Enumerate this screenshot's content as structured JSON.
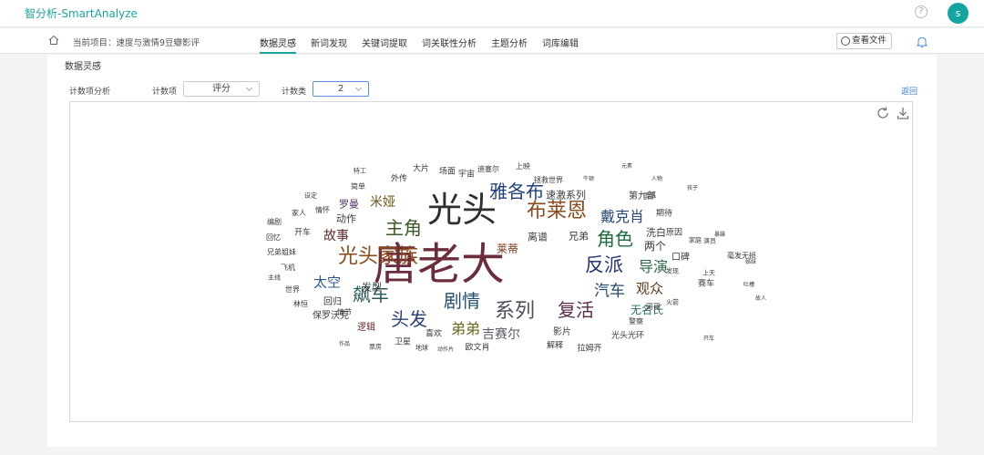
{
  "app": {
    "title": "智分析-SmartAnalyze",
    "help": "?",
    "avatar": "s"
  },
  "nav": {
    "project": "当前项目：速度与激情9豆瓣影评",
    "tabs": [
      "数据灵感",
      "新词发现",
      "关键词提取",
      "词关联性分析",
      "主题分析",
      "词库编辑"
    ],
    "view_file": "查看文件"
  },
  "subtab": "数据灵感",
  "controls": {
    "analysis_label": "计数项分析",
    "count_item_label": "计数项",
    "count_item_value": "评分",
    "count_class_label": "计数类",
    "count_class_value": "2",
    "back": "返回"
  },
  "colors": {
    "accent": "#15a5a0",
    "link": "#3a7bd5"
  },
  "cloud_words": [
    [
      "唐老大",
      48,
      "#6b2c3c"
    ],
    [
      "光头",
      38,
      "#2f2f2f"
    ],
    [
      "光头家族",
      22,
      "#8a4a1c"
    ],
    [
      "布莱恩",
      22,
      "#8a4a1c"
    ],
    [
      "雅各布",
      20,
      "#1f3f7a"
    ],
    [
      "剧情",
      20,
      "#23506e"
    ],
    [
      "系列",
      22,
      "#4e4e5c"
    ],
    [
      "反派",
      21,
      "#27356e"
    ],
    [
      "主角",
      20,
      "#3b5a2a"
    ],
    [
      "角色",
      20,
      "#1e6b3e"
    ],
    [
      "戴克肖",
      16,
      "#274a7a"
    ],
    [
      "复活",
      20,
      "#5a2c4a"
    ],
    [
      "头发",
      20,
      "#2a3f7a"
    ],
    [
      "飙车",
      20,
      "#2a5a5a"
    ],
    [
      "汽车",
      17,
      "#264a6a"
    ],
    [
      "导演",
      16,
      "#2a6a4a"
    ],
    [
      "观众",
      15,
      "#5a3a1a"
    ],
    [
      "弟弟",
      16,
      "#6a6a1a"
    ],
    [
      "太空",
      15,
      "#2a5a8a"
    ],
    [
      "故事",
      14,
      "#5a2a2a"
    ],
    [
      "米娅",
      14,
      "#6a5a1a"
    ],
    [
      "吉赛尔",
      14,
      "#5a5a6a"
    ],
    [
      "莱蒂",
      12,
      "#7a3a1a"
    ],
    [
      "无名氏",
      12,
      "#2a6a6a"
    ],
    [
      "速激系列",
      11,
      "#3a3a3a"
    ],
    [
      "第九部",
      10,
      "#3a3a3a"
    ],
    [
      "两个",
      12,
      "#3a3a3a"
    ],
    [
      "洗白",
      11,
      "#3a3a3a"
    ],
    [
      "兄弟",
      11,
      "#3a3a3a"
    ],
    [
      "离谱",
      11,
      "#3a3a3a"
    ],
    [
      "动作",
      11,
      "#3a3a3a"
    ],
    [
      "罗曼",
      11,
      "#5a3a6a"
    ],
    [
      "发型",
      11,
      "#3a3a3a"
    ],
    [
      "回归",
      10,
      "#3a3a3a"
    ],
    [
      "保罗沃克",
      10,
      "#3a3a3a"
    ],
    [
      "逻辑",
      10,
      "#6a2a2a"
    ],
    [
      "影片",
      10,
      "#3a3a3a"
    ],
    [
      "光头光环",
      9,
      "#3a3a3a"
    ],
    [
      "喜欢",
      9,
      "#3a3a3a"
    ],
    [
      "欧文肖",
      9,
      "#3a3a3a"
    ],
    [
      "卫星",
      9,
      "#3a3a3a"
    ],
    [
      "解释",
      9,
      "#3a3a3a"
    ],
    [
      "拉姆齐",
      9,
      "#3a3a3a"
    ],
    [
      "口碑",
      10,
      "#3a3a3a"
    ],
    [
      "赛车",
      9,
      "#3a3a3a"
    ],
    [
      "期待",
      9,
      "#3a3a3a"
    ],
    [
      "原因",
      9,
      "#3a3a3a"
    ],
    [
      "开车",
      9,
      "#3a3a3a"
    ],
    [
      "外传",
      9,
      "#3a3a3a"
    ],
    [
      "大片",
      9,
      "#3a3a3a"
    ],
    [
      "场面",
      9,
      "#3a3a3a"
    ],
    [
      "宇宙",
      9,
      "#3a3a3a"
    ],
    [
      "上映",
      8,
      "#3a3a3a"
    ],
    [
      "迪塞尔",
      8,
      "#3a3a3a"
    ],
    [
      "拯救世界",
      8,
      "#3a3a3a"
    ],
    [
      "家人",
      8,
      "#3a3a3a"
    ],
    [
      "情怀",
      8,
      "#3a3a3a"
    ],
    [
      "编剧",
      8,
      "#3a3a3a"
    ],
    [
      "回忆",
      8,
      "#3a3a3a"
    ],
    [
      "飞机",
      8,
      "#3a3a3a"
    ],
    [
      "世界",
      8,
      "#3a3a3a"
    ],
    [
      "林恒",
      8,
      "#3a3a3a"
    ],
    [
      "情节",
      8,
      "#3a3a3a"
    ],
    [
      "警察",
      8,
      "#3a3a3a"
    ],
    [
      "哥哥",
      8,
      "#3a3a3a"
    ],
    [
      "团队",
      7,
      "#3a3a3a"
    ],
    [
      "简单",
      8,
      "#3a3a3a"
    ],
    [
      "特工",
      7,
      "#3a3a3a"
    ],
    [
      "兄弟姐妹",
      8,
      "#3a3a3a"
    ],
    [
      "主线",
      7,
      "#3a3a3a"
    ],
    [
      "火箭",
      7,
      "#3a3a3a"
    ],
    [
      "家庭",
      7,
      "#3a3a3a"
    ],
    [
      "上天",
      7,
      "#3a3a3a"
    ],
    [
      "演员",
      7,
      "#3a3a3a"
    ],
    [
      "毫发无损",
      8,
      "#3a3a3a"
    ],
    [
      "发现",
      7,
      "#3a3a3a"
    ],
    [
      "作品",
      6,
      "#3a3a3a"
    ],
    [
      "票房",
      7,
      "#3a3a3a"
    ],
    [
      "地球",
      7,
      "#3a3a3a"
    ],
    [
      "动作片",
      6,
      "#3a3a3a"
    ],
    [
      "设定",
      7,
      "#3a3a3a"
    ],
    [
      "元素",
      6,
      "#3a3a3a"
    ],
    [
      "牛顿",
      6,
      "#3a3a3a"
    ],
    [
      "人物",
      6,
      "#3a3a3a"
    ],
    [
      "孩子",
      6,
      "#3a3a3a"
    ],
    [
      "暴躁",
      6,
      "#3a3a3a"
    ],
    [
      "姊妹",
      6,
      "#3a3a3a"
    ],
    [
      "故人",
      6,
      "#3a3a3a"
    ],
    [
      "吐槽",
      6,
      "#3a3a3a"
    ],
    [
      "开车",
      6,
      "#3a3a3a"
    ]
  ]
}
